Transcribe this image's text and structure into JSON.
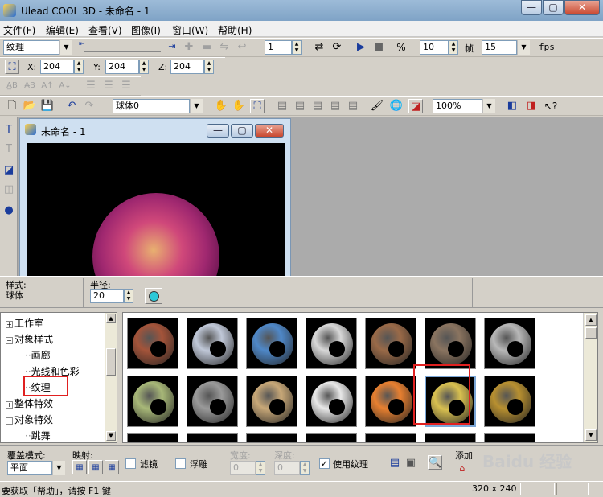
{
  "window": {
    "title": "Ulead COOL 3D - 未命名 - 1",
    "min": "—",
    "max": "▢",
    "close": "✕"
  },
  "menu": [
    "文件(F)",
    "编辑(E)",
    "查看(V)",
    "图像(I)",
    "窗口(W)",
    "帮助(H)"
  ],
  "toolbar1": {
    "category": "纹理",
    "frame_value": "1",
    "frames_value": "10",
    "frames_label": "帧",
    "fps_value": "15",
    "fps_label": "fps"
  },
  "toolbar2": {
    "x_label": "X:",
    "x_value": "204",
    "y_label": "Y:",
    "y_value": "204",
    "z_label": "Z:",
    "z_value": "204"
  },
  "toolbar4": {
    "object_select": "球体0",
    "zoom_select": "100%"
  },
  "document": {
    "title": "未命名 - 1"
  },
  "attributes": {
    "style_label": "样式:",
    "style_value": "球体",
    "radius_label": "半径:",
    "radius_value": "20"
  },
  "tree": {
    "items": [
      {
        "label": "工作室",
        "expander": "+"
      },
      {
        "label": "对象样式",
        "expander": "−"
      },
      {
        "label": "画廊",
        "expander": ""
      },
      {
        "label": "光线和色彩",
        "expander": ""
      },
      {
        "label": "纹理",
        "expander": ""
      },
      {
        "label": "整体特效",
        "expander": "+"
      },
      {
        "label": "对象特效",
        "expander": "−"
      },
      {
        "label": "跳舞",
        "expander": ""
      }
    ]
  },
  "texture_gallery": {
    "thumbnails": [
      {
        "name": "brick-red-texture",
        "color": "#a4543a"
      },
      {
        "name": "cracked-silver-texture",
        "color": "#c0c8d8"
      },
      {
        "name": "blue-stone-texture",
        "color": "#4f88c8"
      },
      {
        "name": "white-brick-texture",
        "color": "#d8d8d8"
      },
      {
        "name": "brown-brick-texture",
        "color": "#9a6a48"
      },
      {
        "name": "brown-rock-texture",
        "color": "#8a7460"
      },
      {
        "name": "silver-wrinkle-texture",
        "color": "#b8b8b8"
      },
      {
        "name": "green-marble-texture",
        "color": "#a8b878"
      },
      {
        "name": "gray-granite-texture",
        "color": "#9a9a9a"
      },
      {
        "name": "tan-stone-texture",
        "color": "#c8a878"
      },
      {
        "name": "chrome-texture",
        "color": "#e8e8e8"
      },
      {
        "name": "orange-plastic-texture",
        "color": "#e88030"
      },
      {
        "name": "gold-brushed-texture",
        "color": "#d8c050"
      },
      {
        "name": "bronze-texture",
        "color": "#b89030"
      }
    ]
  },
  "bottom": {
    "mode_label": "覆盖模式:",
    "mode_value": "平面",
    "mapping_label": "映射:",
    "filter_label": "滤镜",
    "emboss_label": "浮雕",
    "width_label": "宽度:",
    "width_value": "0",
    "depth_label": "深度:",
    "depth_value": "0",
    "use_texture_label": "使用纹理",
    "add_label": "添加"
  },
  "status": {
    "help_text": "要获取「帮助」，请按 F1 键",
    "size": "320 x 240"
  },
  "watermark": "Baidu 经验",
  "colors": {
    "highlight_red": "#e02020",
    "selection_blue": "#7aa6d6",
    "sphere_pink": "#d0487a"
  }
}
